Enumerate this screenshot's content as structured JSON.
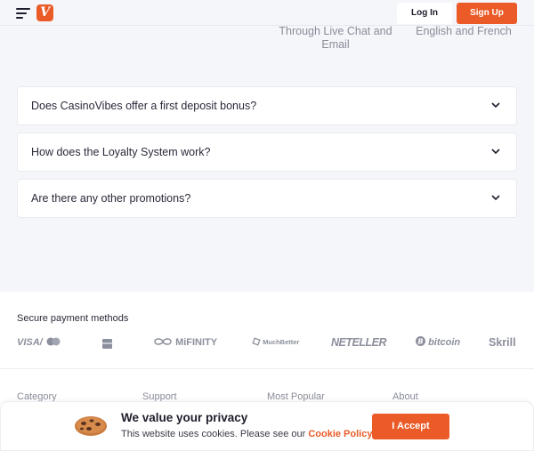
{
  "header": {
    "logo_letter": "V",
    "login_label": "Log In",
    "signup_label": "Sign Up"
  },
  "info": {
    "support_text": "Through Live Chat and Email",
    "languages_text": "English and French"
  },
  "faq": [
    {
      "question": "Does CasinoVibes offer a first deposit bonus?"
    },
    {
      "question": "How does the Loyalty System work?"
    },
    {
      "question": "Are there any other promotions?"
    }
  ],
  "footer": {
    "payment_title": "Secure payment methods",
    "payments": [
      {
        "name": "Visa / Mastercard",
        "label": "VISA/"
      },
      {
        "name": "Bank card",
        "label": ""
      },
      {
        "name": "MiFinity",
        "label": "MiFINITY"
      },
      {
        "name": "MuchBetter",
        "label": "MuchBetter"
      },
      {
        "name": "Neteller",
        "label": "NETELLER"
      },
      {
        "name": "Bitcoin",
        "label": "bitcoin"
      },
      {
        "name": "Skrill",
        "label": "Skrill"
      }
    ],
    "columns": [
      {
        "label": "Category"
      },
      {
        "label": "Support"
      },
      {
        "label": "Most Popular"
      },
      {
        "label": "About"
      }
    ]
  },
  "cookie_banner": {
    "title": "We value your privacy",
    "text": "This website uses cookies. Please see our ",
    "link_label": "Cookie Policy",
    "accept_label": "I Accept"
  },
  "colors": {
    "brand": "#ea5b28",
    "background": "#f5f6fa",
    "text_dark": "#1d1d2b",
    "text_muted": "#8a8c99"
  }
}
